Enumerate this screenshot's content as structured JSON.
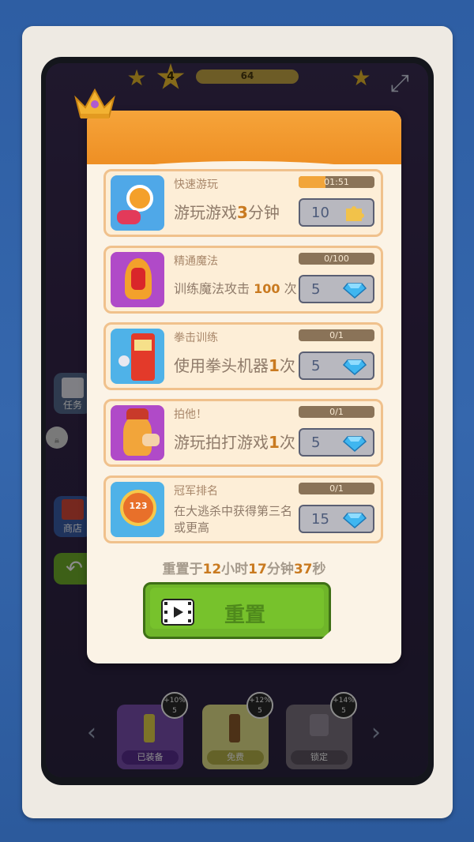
{
  "hud": {
    "progress_text": "64",
    "star_badge_number": "4"
  },
  "sidebar": {
    "tasks_label": "任务",
    "shop_label": "商店"
  },
  "bottom_bar": {
    "cards": [
      {
        "bonus": "+10%\n5",
        "label": "已装备",
        "color": "#7a4fb0",
        "label_bg": "#5a2f90"
      },
      {
        "bonus": "+12%\n5",
        "label": "免费",
        "color": "#e3e28a",
        "label_bg": "#b6b24a"
      },
      {
        "bonus": "+14%\n5",
        "label": "锁定",
        "color": "#7d7380",
        "label_bg": "#5d5562"
      }
    ]
  },
  "modal": {
    "tasks": [
      {
        "title": "快速游玩",
        "desc_prefix": "游玩游戏",
        "desc_num": "3",
        "desc_suffix": "分钟",
        "progress_text": "01:51",
        "progress_fraction": 0.35,
        "reward": "10",
        "reward_icon": "puzzle-icon"
      },
      {
        "title": "精通魔法",
        "desc_prefix": "训练魔法攻击 ",
        "desc_num": "100",
        "desc_suffix": " 次",
        "progress_text": "0/100",
        "progress_fraction": 0,
        "reward": "5",
        "reward_icon": "diamond-icon"
      },
      {
        "title": "拳击训练",
        "desc_prefix": "使用拳头机器",
        "desc_num": "1",
        "desc_suffix": "次",
        "progress_text": "0/1",
        "progress_fraction": 0,
        "reward": "5",
        "reward_icon": "diamond-icon"
      },
      {
        "title": "拍他！",
        "desc_prefix": "游玩拍打游戏",
        "desc_num": "1",
        "desc_suffix": "次",
        "progress_text": "0/1",
        "progress_fraction": 0,
        "reward": "5",
        "reward_icon": "diamond-icon"
      },
      {
        "title": "冠军排名",
        "desc_full": "在大逃杀中获得第三名或更高",
        "progress_text": "0/1",
        "progress_fraction": 0,
        "reward": "15",
        "reward_icon": "diamond-icon"
      }
    ],
    "reset_prefix": "重置于",
    "reset_hours": "12",
    "reset_h_unit": "小时",
    "reset_minutes": "17",
    "reset_m_unit": "分钟",
    "reset_seconds": "37",
    "reset_s_unit": "秒",
    "reset_button_label": "重置"
  },
  "colors": {
    "accent_orange": "#f6a43a",
    "button_green": "#6fb52a",
    "diamond_blue": "#3fb6f0"
  }
}
